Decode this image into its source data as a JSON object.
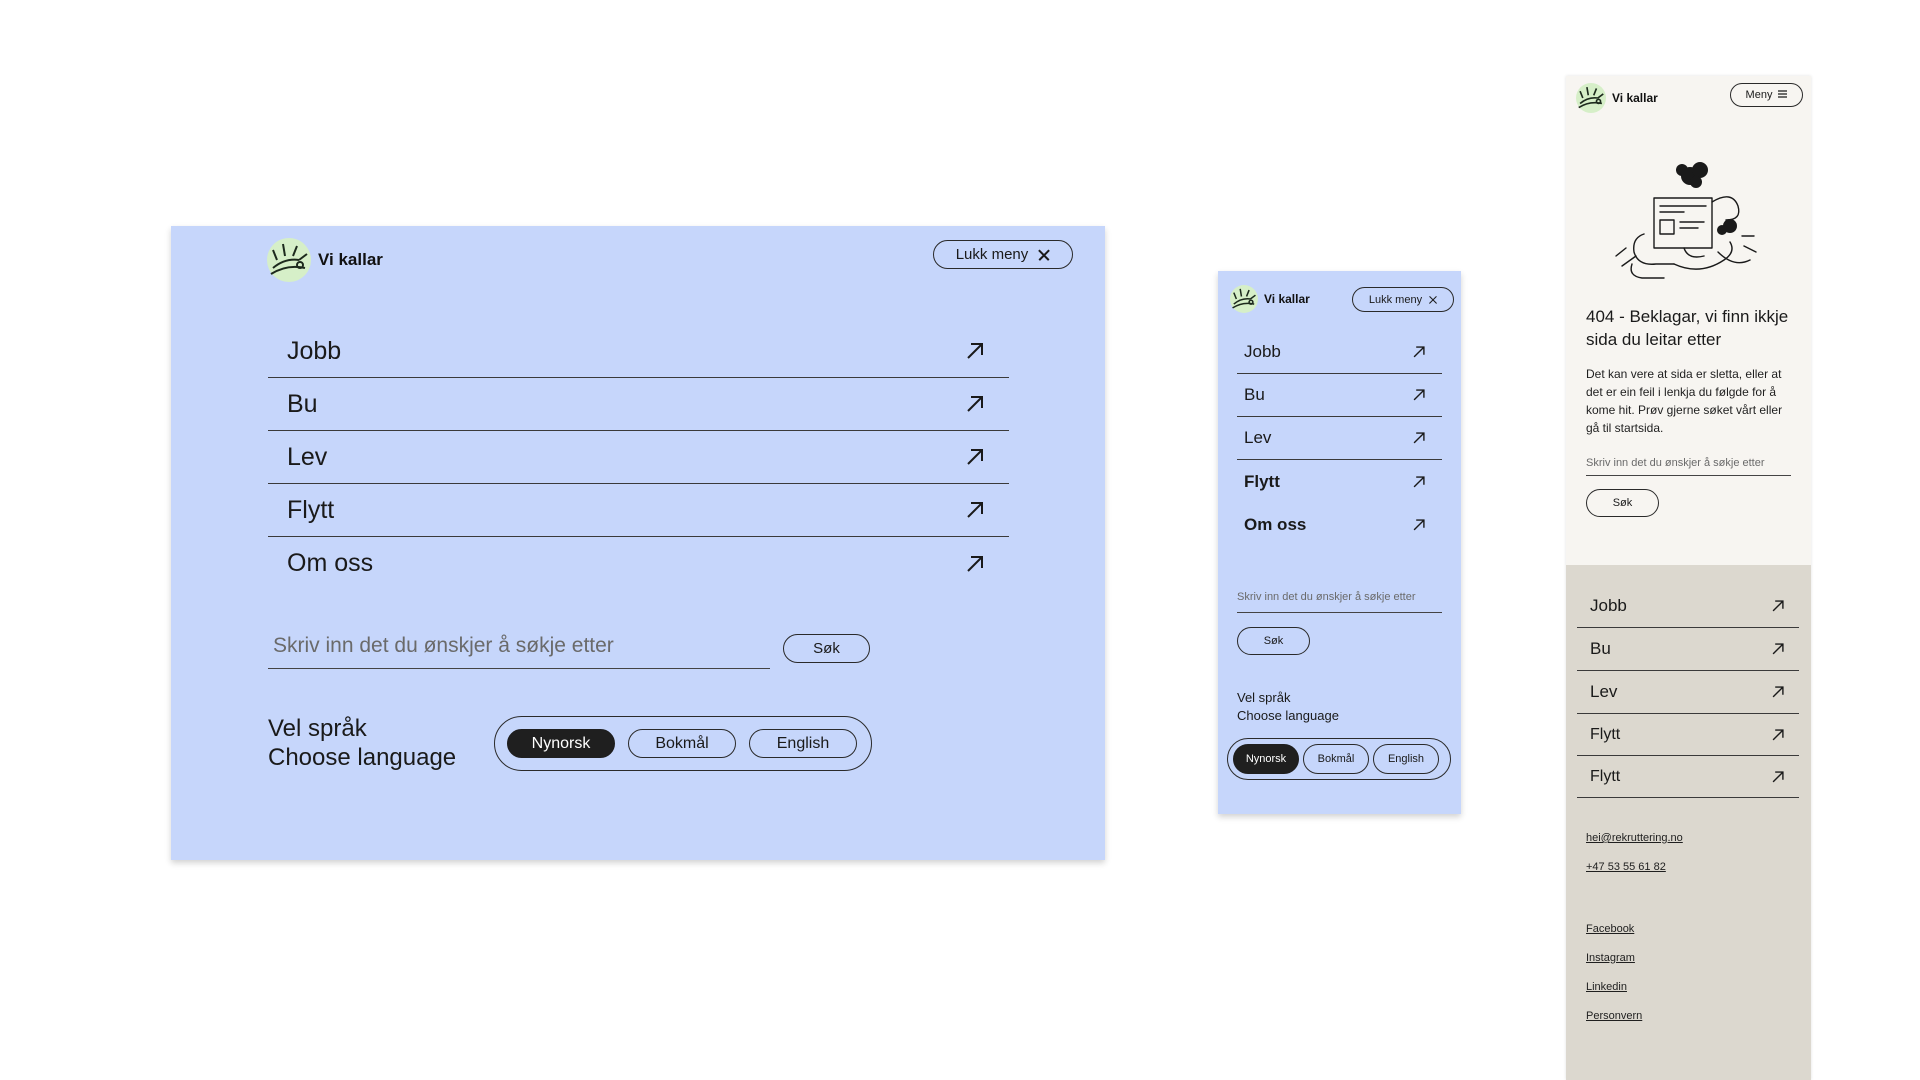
{
  "brand": {
    "name": "Vi kallar"
  },
  "menu_close_label": "Lukk meny",
  "menu_open_label": "Meny",
  "nav": [
    "Jobb",
    "Bu",
    "Lev",
    "Flytt",
    "Om oss"
  ],
  "nav_mobile_404": [
    "Jobb",
    "Bu",
    "Lev",
    "Flytt",
    "Flytt"
  ],
  "search": {
    "placeholder": "Skriv inn det du ønskjer å søkje etter",
    "button": "Søk"
  },
  "language": {
    "heading_nn": "Vel språk",
    "heading_en": "Choose language",
    "options": [
      "Nynorsk",
      "Bokmål",
      "English"
    ],
    "selected": "Nynorsk"
  },
  "error_page": {
    "title": "404 - Beklagar, vi finn ikkje sida du leitar etter",
    "body": "Det kan vere at sida er sletta, eller at det er ein feil i lenkja du følgde for å kome hit. Prøv gjerne søket vårt eller gå til startsida."
  },
  "contact": {
    "email": "hei@rekruttering.no",
    "phone": "+47 53 55 61 82"
  },
  "social": [
    "Facebook",
    "Instagram",
    "Linkedin",
    "Personvern"
  ],
  "colors": {
    "menu_bg": "#c6d6fb",
    "page_bg": "#f7f5f1",
    "footer_bg": "#dcd8cf",
    "logo_bg": "#d6efc8",
    "dark": "#1f1f1f"
  },
  "icons": {
    "nav_arrow": "arrow-up-right-icon",
    "close": "close-icon",
    "menu": "hamburger-icon"
  }
}
